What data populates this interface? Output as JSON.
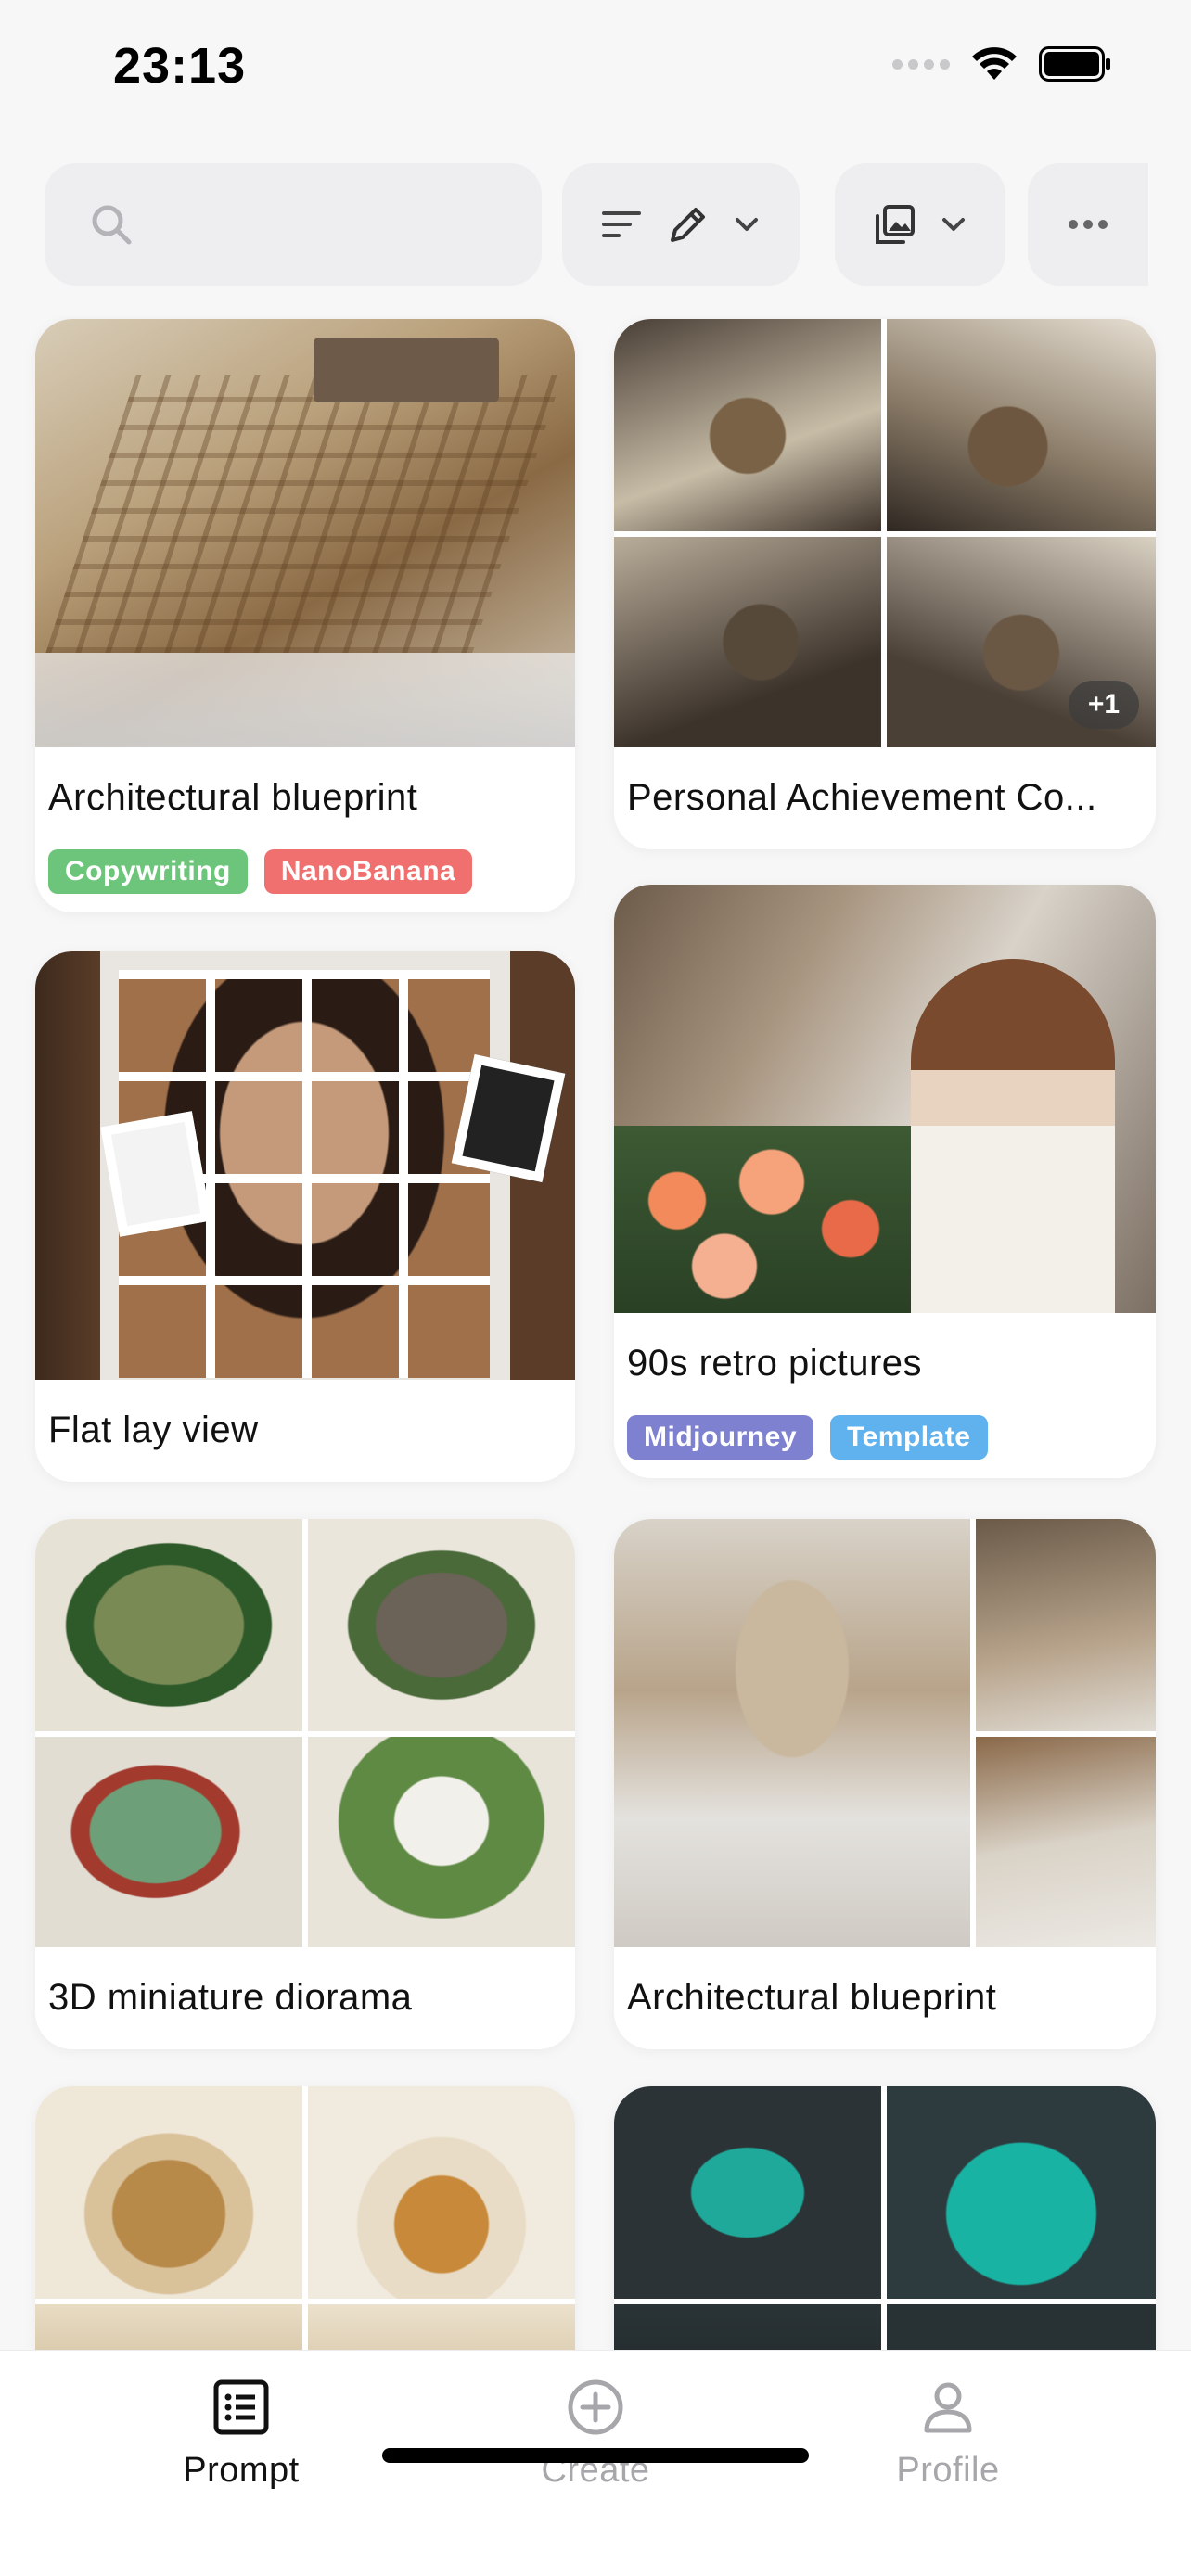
{
  "status_bar": {
    "time": "23:13"
  },
  "toolbar": {
    "search_placeholder": ""
  },
  "colors": {
    "tag_green": "#6cc57a",
    "tag_red": "#f0706f",
    "tag_purple": "#7e80d0",
    "tag_blue": "#5fb2ee",
    "tab_active": "#111111",
    "tab_inactive": "#a7a7ab"
  },
  "cards": [
    {
      "title": "Architectural blueprint",
      "tags": [
        "Copywriting",
        "NanoBanana"
      ],
      "image_count_badge": ""
    },
    {
      "title": "Personal Achievement Co...",
      "tags": [],
      "image_count_badge": "+1"
    },
    {
      "title": "Flat lay view",
      "tags": [],
      "image_count_badge": ""
    },
    {
      "title": "90s retro pictures",
      "tags": [
        "Midjourney",
        "Template"
      ],
      "image_count_badge": ""
    },
    {
      "title": "3D miniature diorama",
      "tags": [],
      "image_count_badge": ""
    },
    {
      "title": "Architectural blueprint",
      "tags": [],
      "image_count_badge": ""
    },
    {
      "title": "",
      "tags": [],
      "image_count_badge": ""
    },
    {
      "title": "",
      "tags": [],
      "image_count_badge": ""
    }
  ],
  "tab_bar": {
    "tabs": [
      {
        "label": "Prompt",
        "icon": "list-icon",
        "active": true
      },
      {
        "label": "Create",
        "icon": "plus-circle-icon",
        "active": false
      },
      {
        "label": "Profile",
        "icon": "person-icon",
        "active": false
      }
    ]
  }
}
